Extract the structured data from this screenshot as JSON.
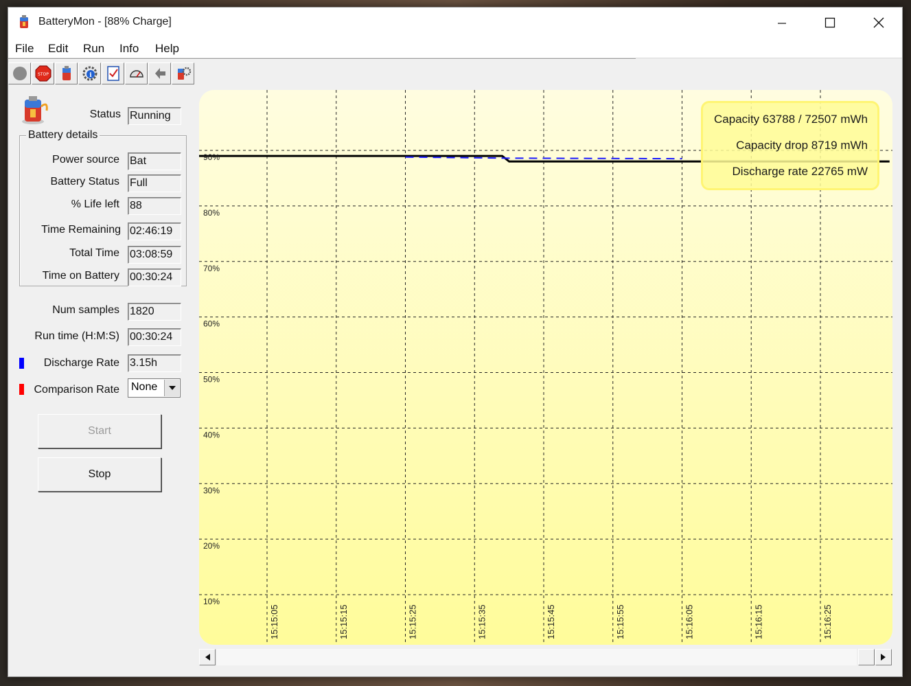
{
  "window": {
    "title": "BatteryMon - [88% Charge]",
    "controls": [
      "minimize-icon",
      "maximize-icon",
      "close-icon"
    ]
  },
  "menu": [
    "File",
    "Edit",
    "Run",
    "Info",
    "Help"
  ],
  "toolbar": [
    "start-icon",
    "stop-sign-icon",
    "battery-icon",
    "info-gear-icon",
    "checklist-icon",
    "gauge-icon",
    "pointer-hand-icon",
    "battery-settings-icon"
  ],
  "status": {
    "label": "Status",
    "value": "Running"
  },
  "battery_details": {
    "title": "Battery details",
    "rows": [
      {
        "label": "Power source",
        "value": "Bat"
      },
      {
        "label": "Battery Status",
        "value": "Full"
      },
      {
        "label": "% Life left",
        "value": "88"
      },
      {
        "label": "Time Remaining",
        "value": "02:46:19"
      },
      {
        "label": "Total Time",
        "value": "03:08:59"
      },
      {
        "label": "Time on Battery",
        "value": "00:30:24"
      }
    ]
  },
  "stats": {
    "num_samples": {
      "label": "Num samples",
      "value": "1820"
    },
    "run_time": {
      "label": "Run time (H:M:S)",
      "value": "00:30:24"
    },
    "discharge_rate": {
      "label": "Discharge Rate",
      "value": "3.15h"
    },
    "comparison_rate": {
      "label": "Comparison Rate",
      "value": "None"
    }
  },
  "buttons": {
    "start": "Start",
    "stop": "Stop"
  },
  "info_box": {
    "capacity": "Capacity 63788 / 72507 mWh",
    "capacity_drop": "Capacity drop 8719 mWh",
    "discharge": "Discharge rate 22765 mW"
  },
  "colors": {
    "discharge_marker": "#0000ff",
    "comparison_marker": "#ff0000",
    "chart_bg": "#fffde0",
    "chart_bg_bottom": "#fffc9a"
  },
  "chart_data": {
    "type": "line",
    "ylabel_ticks": [
      "90%",
      "80%",
      "70%",
      "60%",
      "50%",
      "40%",
      "30%",
      "20%",
      "10%"
    ],
    "y_tick_values": [
      90,
      80,
      70,
      60,
      50,
      40,
      30,
      20,
      10
    ],
    "x_tick_labels": [
      "15:15:05",
      "15:15:15",
      "15:15:25",
      "15:15:35",
      "15:15:45",
      "15:15:55",
      "15:16:05",
      "15:16:15",
      "15:16:25"
    ],
    "grid": true,
    "series": [
      {
        "color": "#000000",
        "points": [
          [
            "15:14:55",
            89
          ],
          [
            "15:15:39",
            89
          ],
          [
            "15:15:40",
            88
          ],
          [
            "15:16:35",
            88
          ]
        ]
      },
      {
        "color": "#1a1aff",
        "points": [
          [
            "15:15:25",
            88.8
          ],
          [
            "15:15:40",
            88.6
          ],
          [
            "15:16:05",
            88.5
          ]
        ]
      }
    ]
  }
}
